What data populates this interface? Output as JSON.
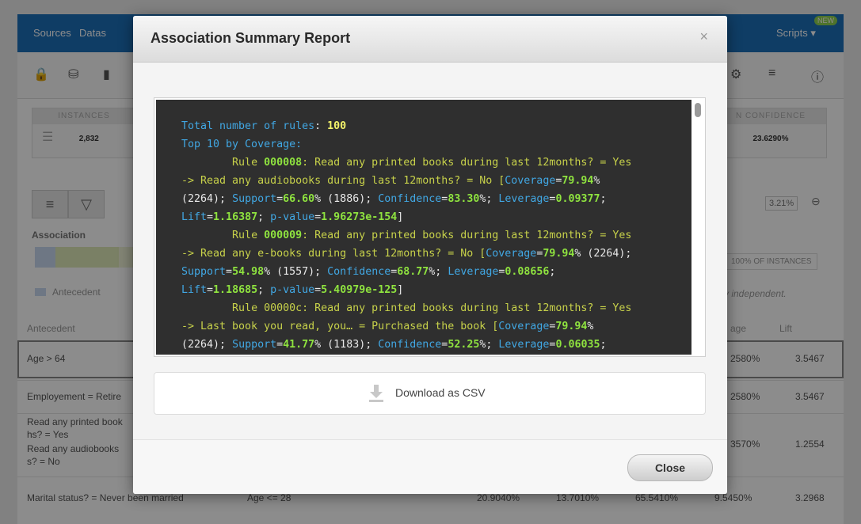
{
  "background": {
    "nav": {
      "tabs": [
        "Sources",
        "Datas"
      ],
      "scripts_label": "Scripts ▾",
      "new_badge": "NEW"
    },
    "stats": {
      "instances_label": "INSTANCES",
      "instances_value": "2,832",
      "confidence_label": "N CONFIDENCE",
      "confidence_value": "23.6290%"
    },
    "filter_value": "3.21%",
    "association_label": "Association",
    "instances_pct": "100% OF INSTANCES",
    "legend_antecedent": "Antecedent",
    "independent_note": "y independent.",
    "table_headers": {
      "antecedent": "Antecedent",
      "coverage": "age",
      "lift": "Lift"
    },
    "rows": [
      {
        "antecedent": "Age > 64",
        "coverage": "2580%",
        "lift": "3.5467"
      },
      {
        "antecedent": "Employement = Retire",
        "coverage": "2580%",
        "lift": "3.5467"
      },
      {
        "antecedent_l1": "Read any printed book",
        "antecedent_l2": "hs? = Yes",
        "antecedent_l3": "Read any audiobooks",
        "antecedent_l4": "s? = No",
        "coverage": "3570%",
        "lift": "1.2554"
      },
      {
        "antecedent": "Marital status? = Never been married",
        "consequent": "Age <= 28",
        "c1": "20.9040%",
        "c2": "13.7010%",
        "c3": "65.5410%",
        "coverage": "9.5450%",
        "lift": "3.2968"
      }
    ]
  },
  "modal": {
    "title": "Association Summary Report",
    "close_x": "×",
    "download_label": "Download as CSV",
    "close_label": "Close"
  },
  "report": {
    "total_rules_key": "Total number of rules",
    "total_rules_value": "100",
    "top_heading": "Top 10 by Coverage",
    "rules": [
      {
        "rule_prefix": "Rule ",
        "rule_id": "000008",
        "l1_rest": ": Read any printed books during last 12months? = Yes",
        "l2_text": "-> Read any audiobooks during last 12months? = No [",
        "coverage": "79.94",
        "l3_count1": "(2264)",
        "support": "66.60",
        "count2": "(1886)",
        "confidence": "83.30",
        "leverage": "0.09377",
        "lift": "1.16387",
        "pvalue": "1.96273e-154"
      },
      {
        "rule_prefix": "Rule ",
        "rule_id": "000009",
        "l1_rest": ": Read any printed books during last 12months? = Yes",
        "l2_text": "-> Read any e-books during last 12months? = No [",
        "coverage": "79.94",
        "count1": "(2264)",
        "support": "54.98",
        "count2": "(1557)",
        "confidence": "68.77",
        "leverage": "0.08656",
        "lift": "1.18685",
        "pvalue": "5.40979e-125"
      },
      {
        "rule_prefix": "Rule ",
        "rule_id": "00000c",
        "l1_rest": ": Read any printed books during last 12months? = Yes",
        "l2_text": "-> Last book you read, you… = Purchased the book [",
        "coverage": "79.94",
        "count1": "(2264)",
        "support": "41.77",
        "count2": "(1183)",
        "confidence": "52.25",
        "leverage": "0.06035"
      }
    ]
  }
}
